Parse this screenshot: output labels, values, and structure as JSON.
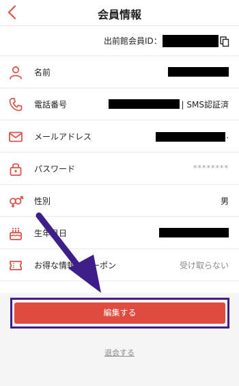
{
  "header": {
    "title": "会員情報",
    "accent": "#d9534a"
  },
  "member_id": {
    "label": "出前館会員ID："
  },
  "rows": [
    {
      "label": "名前",
      "icon": "person-icon"
    },
    {
      "label": "電話番号",
      "suffix": "| SMS認証済",
      "icon": "phone-icon"
    },
    {
      "label": "メールアドレス",
      "suffix": ".",
      "icon": "mail-icon"
    },
    {
      "label": "パスワード",
      "value": "********",
      "icon": "lock-icon"
    },
    {
      "label": "性別",
      "value": "男",
      "icon": "gender-icon"
    },
    {
      "label": "生年月日",
      "icon": "cake-icon"
    },
    {
      "label": "お得な情報・クーポン",
      "value": "受け取らない",
      "icon": "coupon-icon"
    }
  ],
  "edit_button": {
    "label": "編集する",
    "color": "#e04b3f",
    "highlight": "#3e1f8a"
  },
  "withdraw_link": {
    "label": "退会する"
  },
  "annotation": {
    "arrow_color": "#3e1f8a"
  }
}
